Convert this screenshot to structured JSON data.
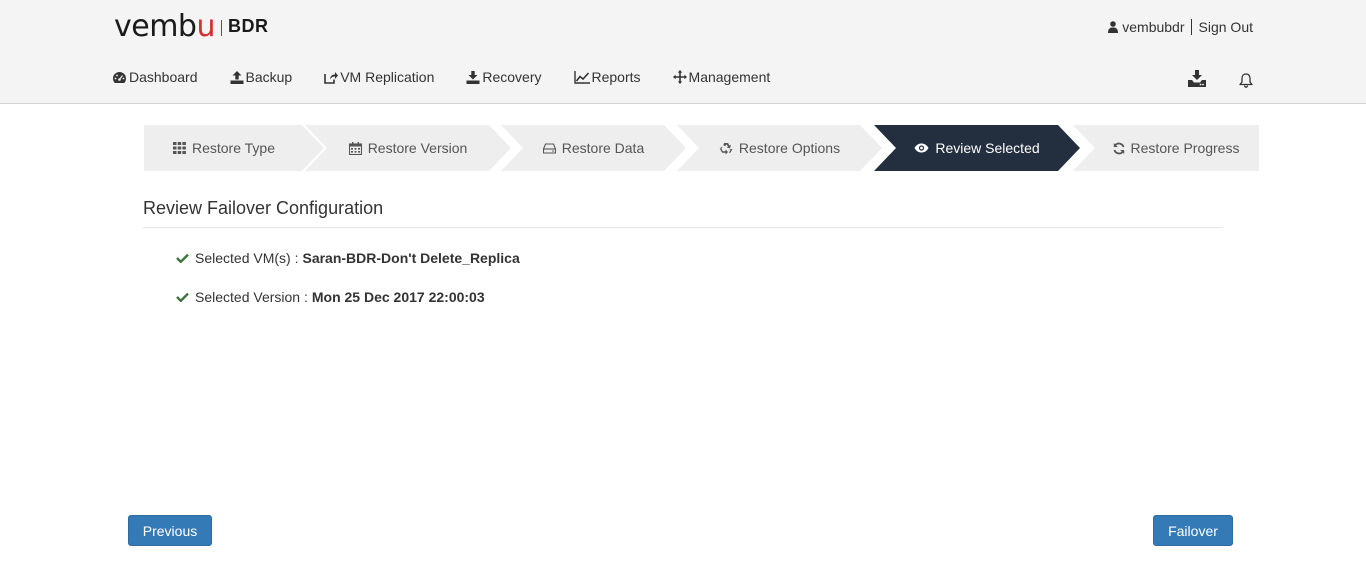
{
  "brand": {
    "logo_prefix": "vemb",
    "logo_accent": "u",
    "product": "BDR",
    "accent_color": "#d32f2f"
  },
  "user": {
    "username": "vembubdr",
    "sign_out": "Sign Out"
  },
  "nav": {
    "items": [
      {
        "label": "Dashboard",
        "icon": "dashboard-icon"
      },
      {
        "label": "Backup",
        "icon": "upload-icon"
      },
      {
        "label": "VM Replication",
        "icon": "share-icon"
      },
      {
        "label": "Recovery",
        "icon": "download-icon"
      },
      {
        "label": "Reports",
        "icon": "line-chart-icon"
      },
      {
        "label": "Management",
        "icon": "arrows-icon"
      }
    ]
  },
  "header_icons": [
    "download-tray-icon",
    "bell-icon"
  ],
  "wizard": {
    "active_color": "#232f3e",
    "inactive_color": "#eeeeee",
    "steps": [
      {
        "label": "Restore Type",
        "icon": "grid-icon",
        "active": false
      },
      {
        "label": "Restore Version",
        "icon": "calendar-icon",
        "active": false
      },
      {
        "label": "Restore Data",
        "icon": "hdd-icon",
        "active": false
      },
      {
        "label": "Restore Options",
        "icon": "recycle-icon",
        "active": false
      },
      {
        "label": "Review Selected",
        "icon": "eye-icon",
        "active": true
      },
      {
        "label": "Restore Progress",
        "icon": "refresh-icon",
        "active": false
      }
    ]
  },
  "review": {
    "title": "Review Failover Configuration",
    "vm_label": "Selected VM(s) :",
    "vm_value": "Saran-BDR-Don't Delete_Replica",
    "version_label": "Selected Version :",
    "version_value": "Mon 25 Dec 2017 22:00:03",
    "check_color": "#3c763d"
  },
  "buttons": {
    "previous": "Previous",
    "failover": "Failover",
    "primary_color": "#337ab7"
  }
}
